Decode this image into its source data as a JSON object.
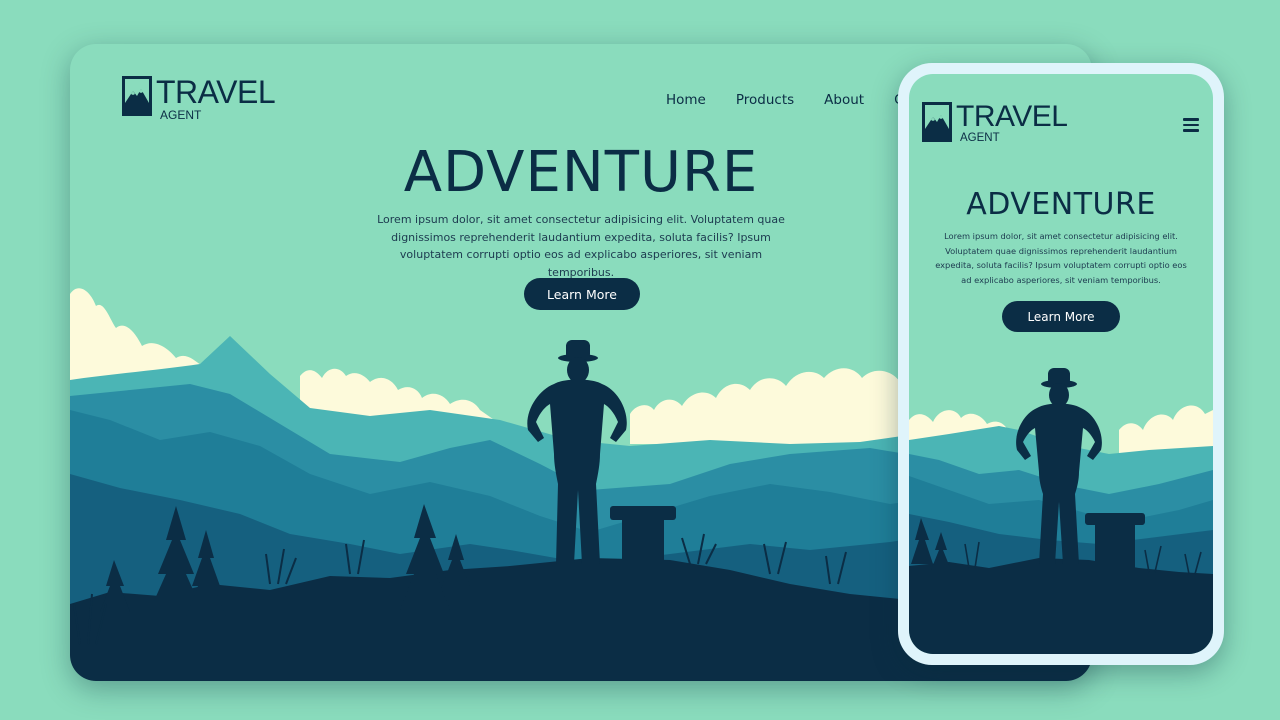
{
  "brand": {
    "word": "TRAVEL",
    "sub": "AGENT"
  },
  "desktop": {
    "nav": [
      "Home",
      "Products",
      "About",
      "Co"
    ],
    "hero": {
      "title": "ADVENTURE",
      "text": "Lorem ipsum dolor, sit amet consectetur adipisicing elit. Voluptatem quae dignissimos reprehenderit laudantium expedita, soluta facilis? Ipsum voluptatem corrupti optio eos ad explicabo asperiores, sit veniam temporibus.",
      "button": "Learn More"
    }
  },
  "mobile": {
    "menu_icon": "hamburger-menu-icon",
    "hero": {
      "title": "ADVENTURE",
      "text": "Lorem ipsum dolor, sit amet consectetur adipisicing elit. Voluptatem quae dignissimos reprehenderit laudantium expedita, soluta facilis? Ipsum voluptatem corrupti optio eos ad explicabo asperiores, sit veniam temporibus.",
      "button": "Learn More"
    }
  },
  "colors": {
    "background": "#8adcbd",
    "navy": "#0b2d45",
    "cloud": "#fdfadb",
    "mountain_light": "#4bb5b5",
    "mountain_mid": "#1f7e98",
    "mountain_dark": "#145a7a",
    "phone_frame": "#dff4fb"
  }
}
